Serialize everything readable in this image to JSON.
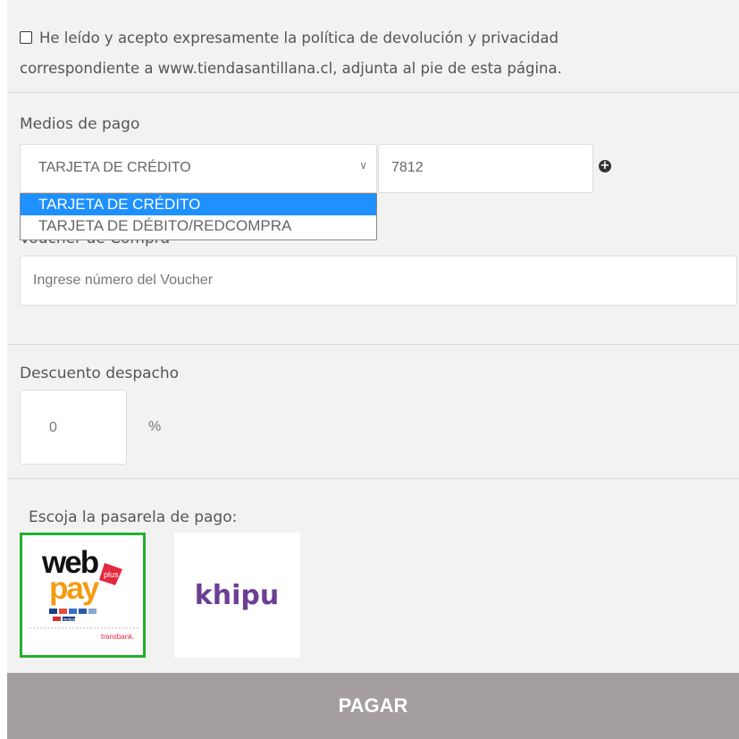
{
  "terms": {
    "line1": "He leído y acepto expresamente la política de devolución y privacidad",
    "line2": "correspondiente a www.tiendasantillana.cl, adjunta al pie de esta página."
  },
  "payment": {
    "label": "Medios de pago",
    "selected": "TARJETA DE CRÉDITO",
    "card_digits": "7812",
    "options": [
      "TARJETA DE CRÉDITO",
      "TARJETA DE DÉBITO/REDCOMPRA"
    ]
  },
  "voucher": {
    "label": "Voucher de Compra",
    "placeholder": "Ingrese número del Voucher"
  },
  "discount": {
    "label": "Descuento despacho",
    "value": "0",
    "unit": "%"
  },
  "gateway": {
    "label": "Escoja la pasarela de pago:",
    "webpay": {
      "word1": "web",
      "word2": "pay",
      "badge": "plus",
      "brand": "transbank.",
      "mini": "webpay"
    },
    "khipu": "khipu"
  },
  "submit": "PAGAR",
  "colors": {
    "selected_border": "#22b02e",
    "dropdown_highlight": "#1e90ff",
    "pay_button": "#a49e9e",
    "khipu": "#6b3f94",
    "webpay_orange": "#f39c12",
    "webpay_red": "#e2293f"
  }
}
